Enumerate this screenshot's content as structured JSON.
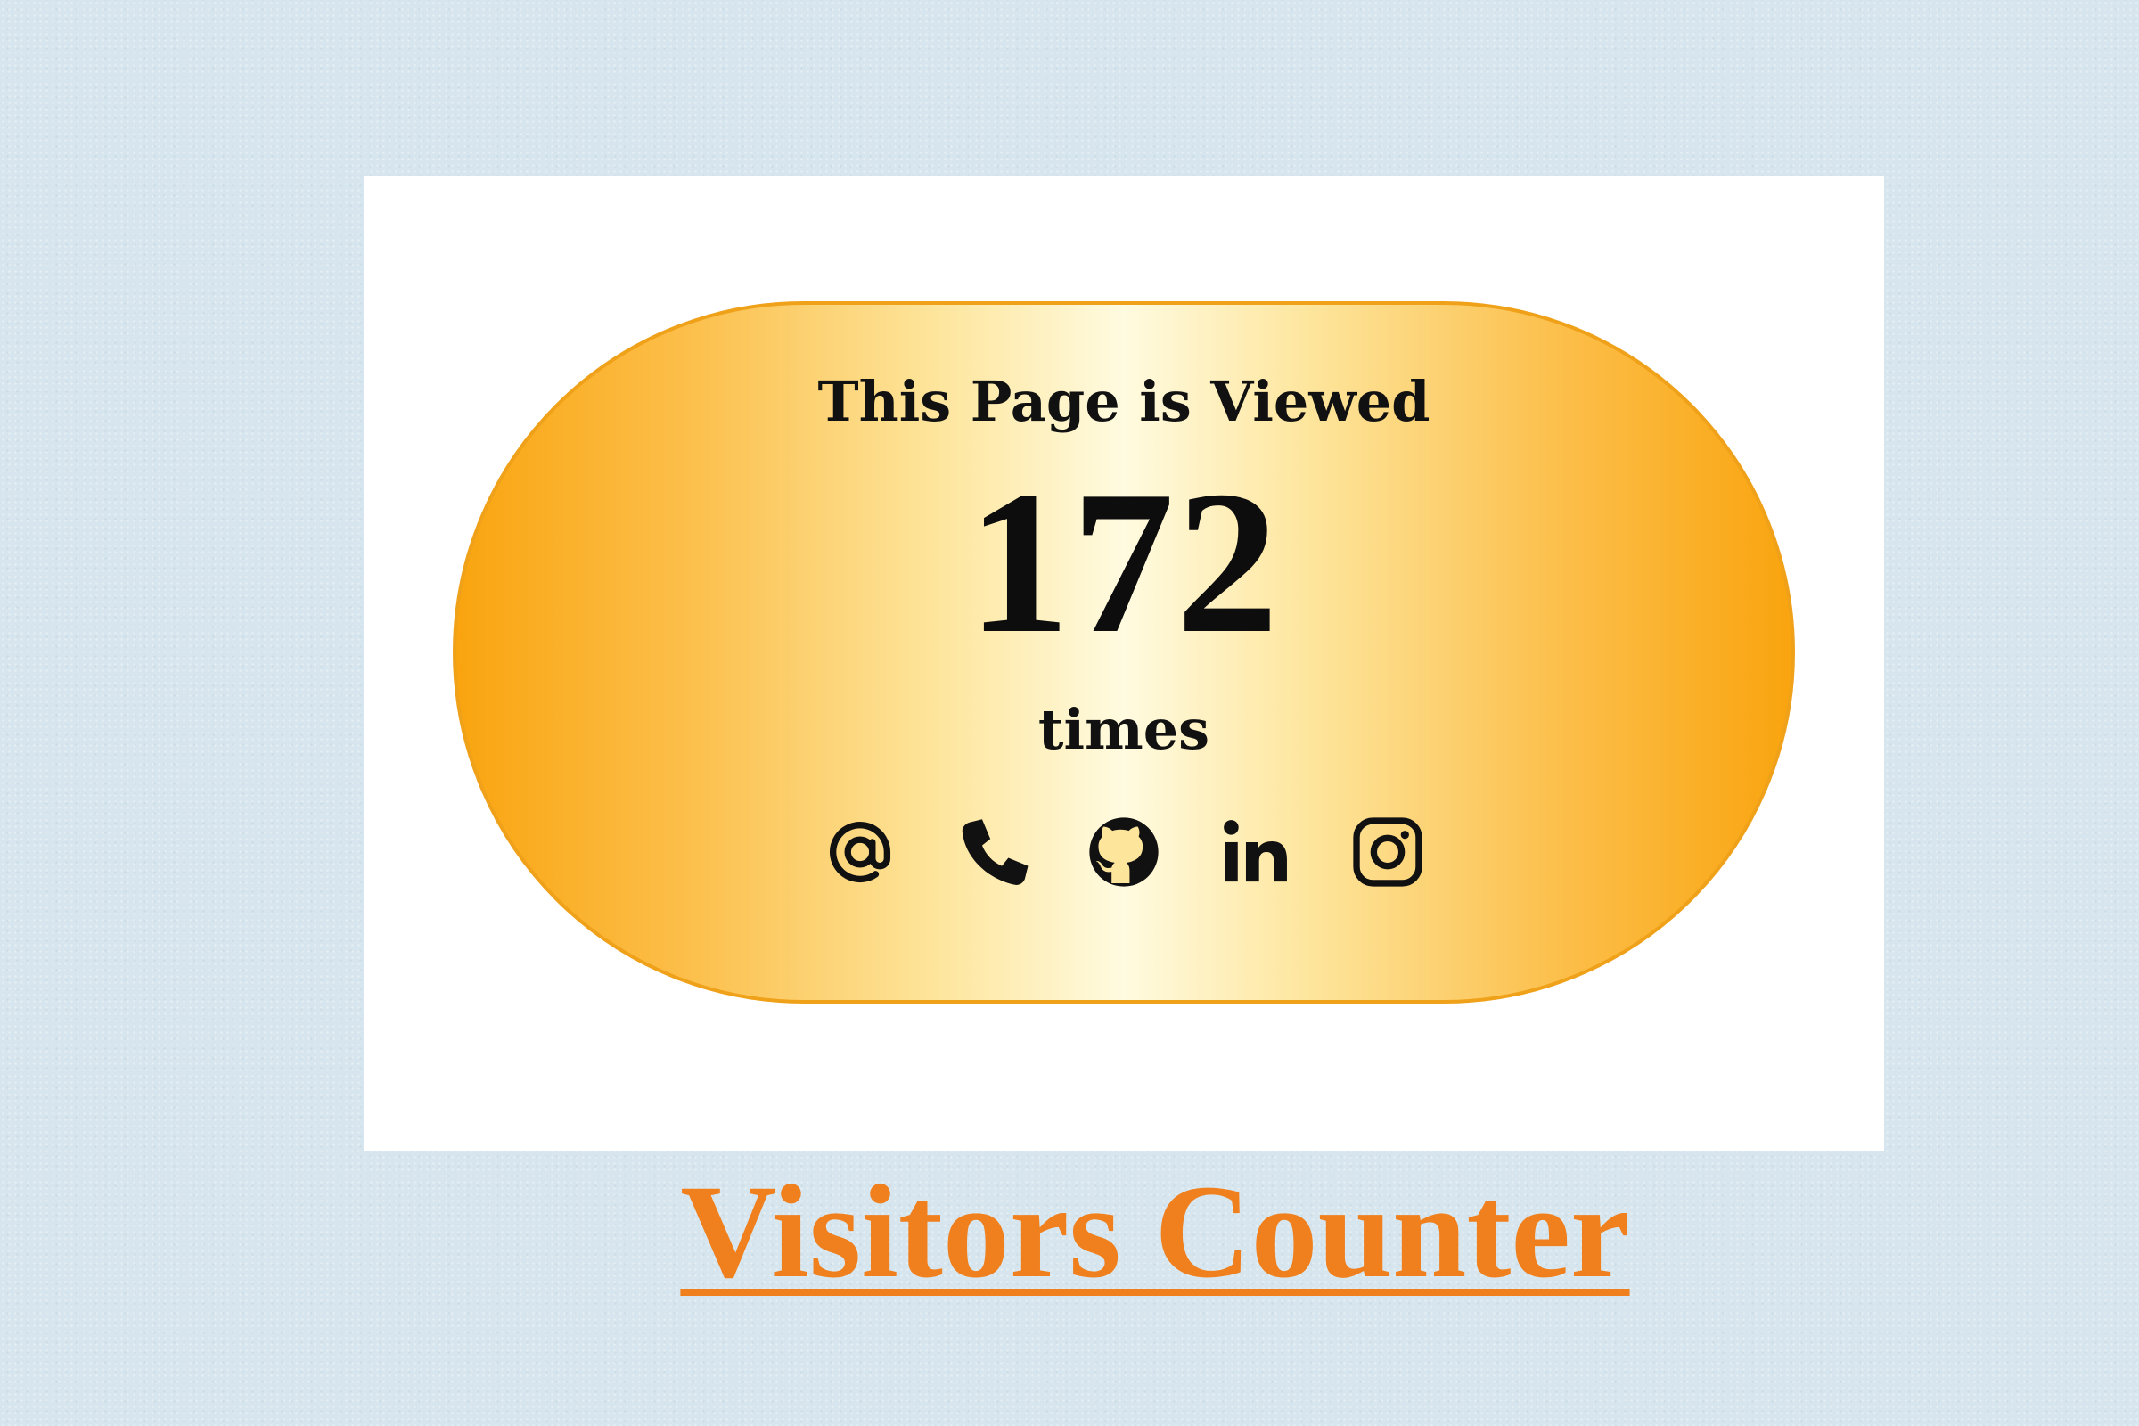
{
  "counter": {
    "heading": "This Page is Viewed",
    "count": "172",
    "suffix": "times",
    "icons": [
      "at-icon",
      "phone-icon",
      "github-icon",
      "linkedin-icon",
      "instagram-icon"
    ]
  },
  "caption": {
    "title": "Visitors Counter"
  },
  "colors": {
    "background": "#d7e6ee",
    "pill_edge": "#f9a40f",
    "pill_center": "#fffbe0",
    "title": "#f07f1d"
  }
}
